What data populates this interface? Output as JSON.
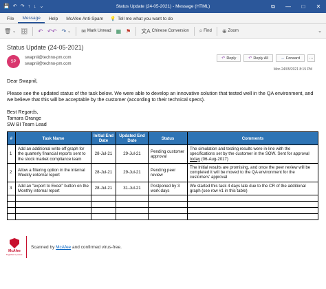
{
  "window": {
    "title": "Status Update (24-05-2021) - Message (HTML)",
    "controls": [
      "—",
      "□",
      "✕"
    ],
    "restore_glyph": "⧉"
  },
  "qat": {
    "save": "💾",
    "undo": "↶",
    "redo": "↷",
    "up": "↑",
    "down": "↓",
    "more": "⌄"
  },
  "menu": {
    "file": "File",
    "message": "Message",
    "help": "Help",
    "antispam": "McAfee Anti-Spam",
    "tellme_icon": "💡",
    "tellme": "Tell me what you want to do"
  },
  "ribbon": {
    "delete": "🗑",
    "delete_dd": "⌄",
    "archive": "🗄",
    "reply": "↶",
    "reply_all": "↶↶",
    "forward": "↷",
    "more": "⌄",
    "mark_unread_icon": "✉",
    "mark_unread": "Mark Unread",
    "categorize": "▦",
    "follow": "⚑",
    "translate_icon": "文A",
    "translate": "Chinese Conversion",
    "find_icon": "⌕",
    "find": "Find",
    "zoom_icon": "⊕",
    "zoom": "Zoom",
    "collapse": "⌄"
  },
  "message": {
    "subject": "Status Update (24-05-2021)",
    "avatar": "SP",
    "from": "swapnil@techno-pm.com",
    "to": "swapnil@techno-pm.com",
    "datetime": "Mon 24/05/2021 8:15 PM",
    "actions": {
      "reply_icon": "↶",
      "reply": "Reply",
      "reply_all_icon": "↶",
      "reply_all": "Reply All",
      "forward_icon": "→",
      "forward": "Forward",
      "more": "···"
    },
    "greeting": "Dear Swapnil,",
    "paragraph": "Please see the updated status of the task below. We were able to develop an innovative solution that tested well in the QA environment, and we believe that this will be acceptable by the customer (according to their technical specs).",
    "signature": [
      "Best Regards,",
      "Tamara Orange",
      "SW BI Team Lead"
    ]
  },
  "table": {
    "headers": [
      "#",
      "Task Name",
      "Initial End Date",
      "Updated End Date",
      "Status",
      "Comments"
    ],
    "rows": [
      {
        "num": "1",
        "task": "Add an additional write-off graph for the quarterly financial reports sent to the stock market compliance team",
        "initial": "28-Jul-21",
        "updated": "29-Jul-21",
        "status": "Pending customer approval",
        "comment_pre": "The simulation and testing results were in-line with the specifications set by the customer in the SOW. Sent for approval ",
        "comment_link": "today",
        "comment_post": " (06-Aug-2017)"
      },
      {
        "num": "2",
        "task": "Allow a filtering option in the internal Weekly external report",
        "initial": "28-Jul-21",
        "updated": "29-Jul-21",
        "status": "Pending peer review",
        "comment": "The Initial results are promising, and once the peer review will be completed it will be moved to the QA environment for the customers' approval"
      },
      {
        "num": "3",
        "task": "Add an \"export to Excel\" button on the Monthly internal report",
        "initial": "28-Jul-21",
        "updated": "31-Jul-21",
        "status": "Postponed by 3 work days",
        "comment": "We started this task 4 days late due to the CR of the additional graph (see row #1 in this table)"
      }
    ]
  },
  "footer": {
    "brand": "McAfee",
    "tagline": "Together is power.",
    "scan_pre": "Scanned by ",
    "scan_link": "McAfee",
    "scan_post": " and confirmed virus-free."
  }
}
